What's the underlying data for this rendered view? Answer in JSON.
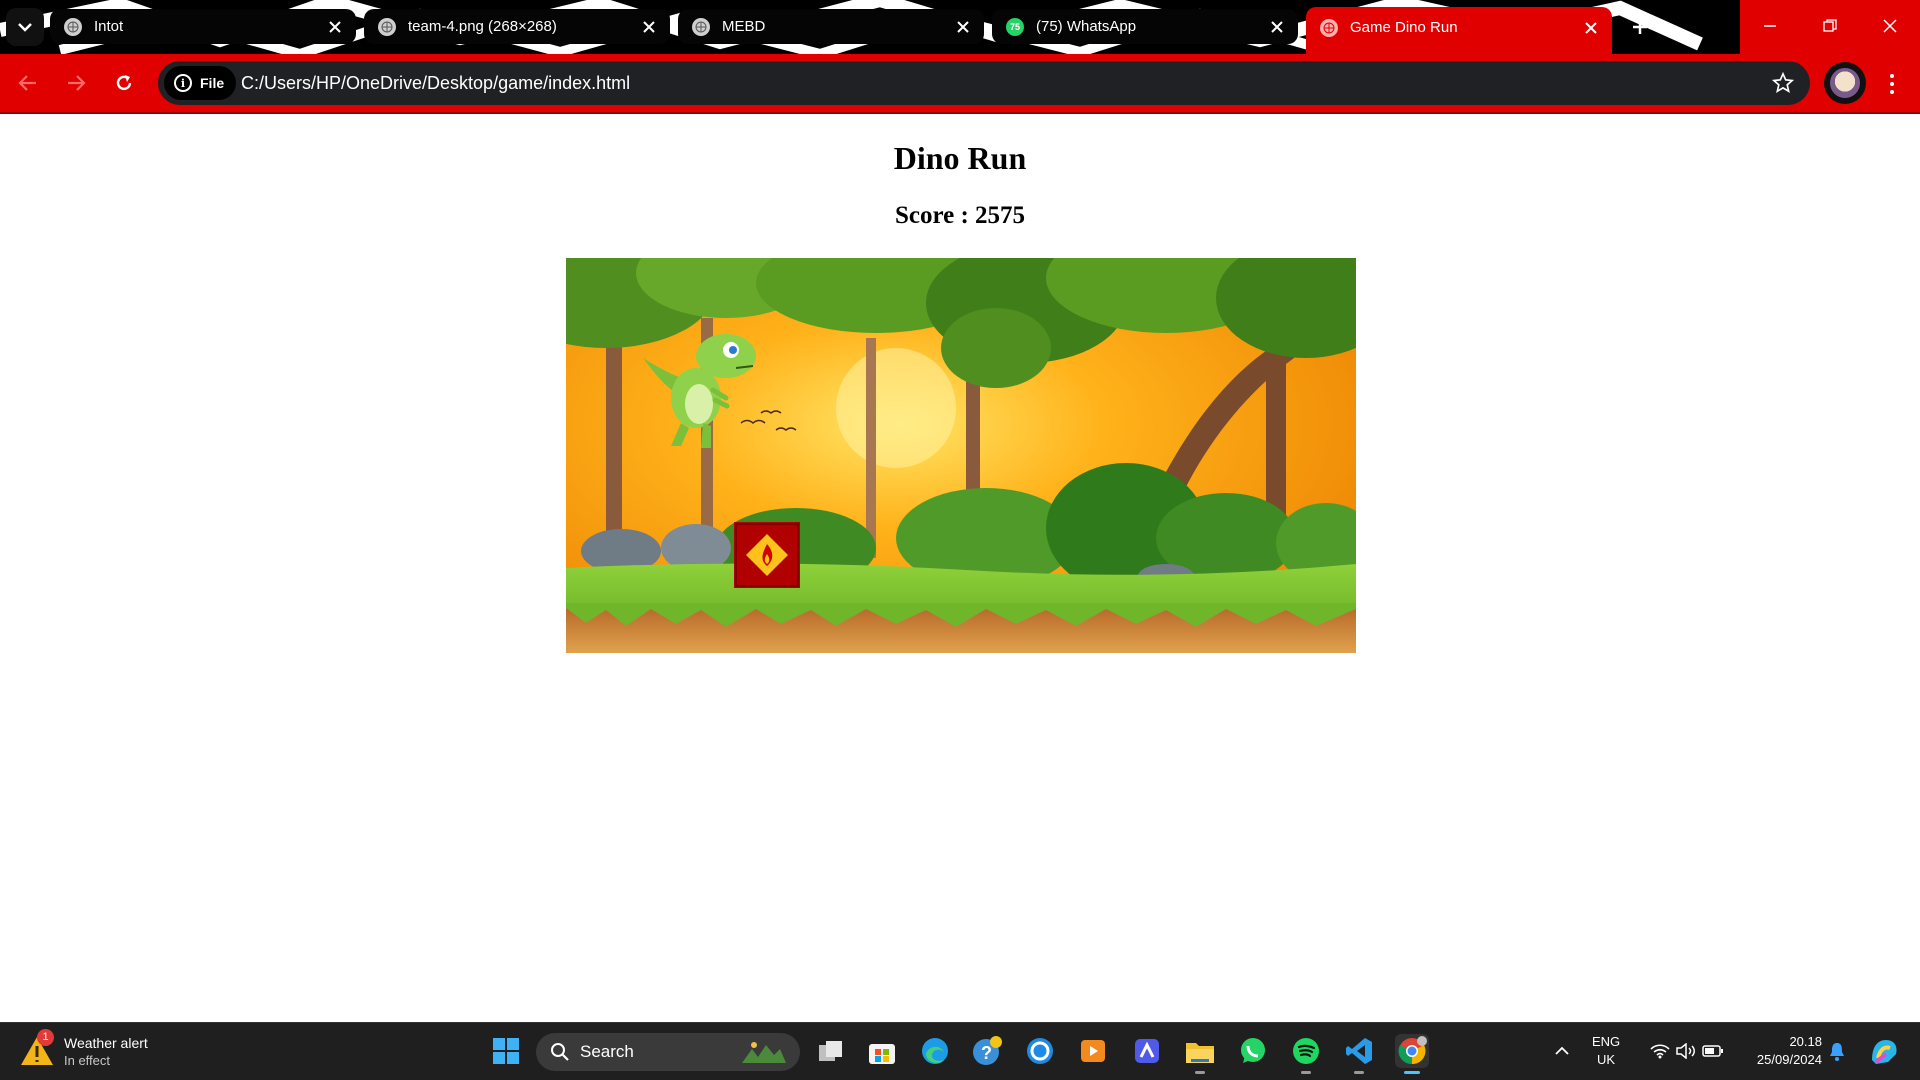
{
  "browser": {
    "tabs": [
      {
        "label": "Intot",
        "favicon": "globe-icon"
      },
      {
        "label": "team-4.png (268×268)",
        "favicon": "globe-icon"
      },
      {
        "label": "MEBD",
        "favicon": "globe-icon"
      },
      {
        "label": "(75) WhatsApp",
        "favicon": "whatsapp-icon",
        "badge": "75"
      },
      {
        "label": "Game Dino Run",
        "favicon": "globe-icon",
        "active": true
      }
    ],
    "site_chip": "File",
    "url": "C:/Users/HP/OneDrive/Desktop/game/index.html",
    "theme_color": "#e00000"
  },
  "page": {
    "title": "Dino Run",
    "score": "Score : 2575"
  },
  "taskbar": {
    "weather_title": "Weather alert",
    "weather_subtitle": "In effect",
    "weather_badge": "1",
    "search_label": "Search",
    "apps": [
      "windows-start-icon",
      "task-view-icon",
      "microsoft-store-icon",
      "edge-icon",
      "get-help-icon",
      "cortana-icon",
      "media-player-icon",
      "linear-icon",
      "file-explorer-icon",
      "whatsapp-icon",
      "spotify-icon",
      "vscode-icon",
      "chrome-icon"
    ],
    "lang_top": "ENG",
    "lang_bottom": "UK",
    "time": "20.18",
    "date": "25/09/2024"
  }
}
